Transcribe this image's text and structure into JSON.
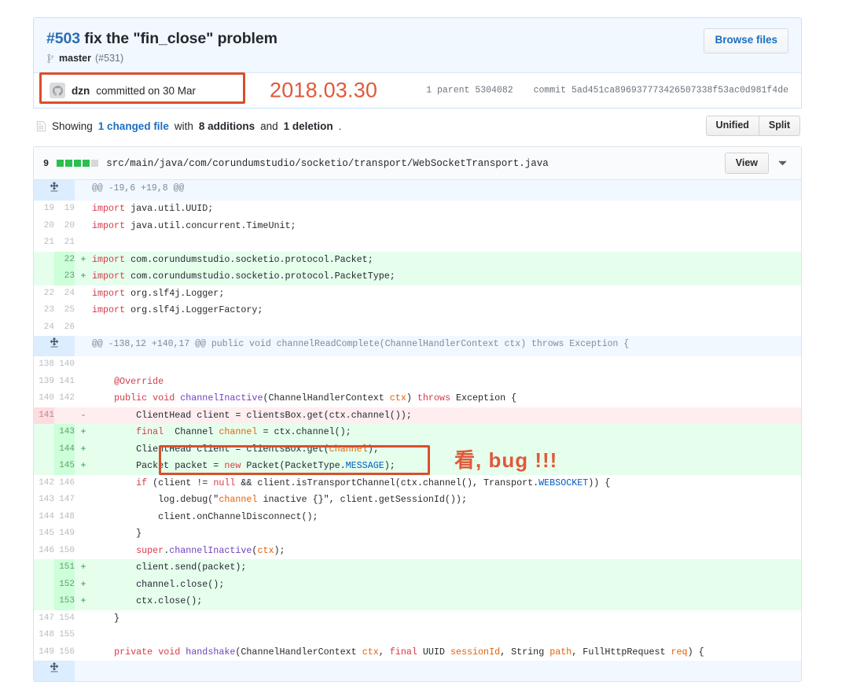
{
  "commit": {
    "number": "#503",
    "title_rest": " fix the \"fin_close\" problem",
    "branch_name": "master",
    "branch_pr": "(#531)",
    "browse_files_label": "Browse files",
    "author": "dzn",
    "committed_text": "committed on 30 Mar",
    "annotation_date": "2018.03.30",
    "parent_label": "1 parent",
    "parent_sha": "5304082",
    "commit_label": "commit",
    "commit_sha": "5ad451ca896937773426507338f53ac0d981f4de"
  },
  "summary": {
    "prefix": "Showing",
    "changed_file": "1 changed file",
    "with": "with",
    "additions": "8 additions",
    "and": "and",
    "deletions": "1 deletion",
    "period": ".",
    "view_unified": "Unified",
    "view_split": "Split"
  },
  "file": {
    "stat_count": "9",
    "stat_blocks": [
      "add",
      "add",
      "add",
      "add",
      "none"
    ],
    "path": "src/main/java/com/corundumstudio/socketio/transport/WebSocketTransport.java",
    "view_label": "View",
    "chevron": "chevron-down"
  },
  "annotations": {
    "bug_text": "看, bug !!!"
  },
  "hunks": [
    {
      "header": "@@ -19,6 +19,8 @@",
      "rows": [
        {
          "type": "ctx",
          "old": "19",
          "new": "19",
          "marker": "",
          "code": "import java.util.UUID;"
        },
        {
          "type": "ctx",
          "old": "20",
          "new": "20",
          "marker": "",
          "code": "import java.util.concurrent.TimeUnit;"
        },
        {
          "type": "ctx",
          "old": "21",
          "new": "21",
          "marker": "",
          "code": ""
        },
        {
          "type": "add",
          "old": "",
          "new": "22",
          "marker": "+",
          "code": "import com.corundumstudio.socketio.protocol.Packet;"
        },
        {
          "type": "add",
          "old": "",
          "new": "23",
          "marker": "+",
          "code": "import com.corundumstudio.socketio.protocol.PacketType;"
        },
        {
          "type": "ctx",
          "old": "22",
          "new": "24",
          "marker": "",
          "code": "import org.slf4j.Logger;"
        },
        {
          "type": "ctx",
          "old": "23",
          "new": "25",
          "marker": "",
          "code": "import org.slf4j.LoggerFactory;"
        },
        {
          "type": "ctx",
          "old": "24",
          "new": "26",
          "marker": "",
          "code": ""
        }
      ]
    },
    {
      "header": "@@ -138,12 +140,17 @@ public void channelReadComplete(ChannelHandlerContext ctx) throws Exception {",
      "rows": [
        {
          "type": "ctx",
          "old": "138",
          "new": "140",
          "marker": "",
          "code": ""
        },
        {
          "type": "ctx",
          "old": "139",
          "new": "141",
          "marker": "",
          "code": "    @Override"
        },
        {
          "type": "ctx",
          "old": "140",
          "new": "142",
          "marker": "",
          "code": "    public void channelInactive(ChannelHandlerContext ctx) throws Exception {"
        },
        {
          "type": "del",
          "old": "141",
          "new": "",
          "marker": "-",
          "code": "        ClientHead client = clientsBox.get(ctx.channel());"
        },
        {
          "type": "add",
          "old": "",
          "new": "143",
          "marker": "+",
          "code": "        final  Channel channel = ctx.channel();"
        },
        {
          "type": "add",
          "old": "",
          "new": "144",
          "marker": "+",
          "code": "        ClientHead client = clientsBox.get(channel);"
        },
        {
          "type": "add",
          "old": "",
          "new": "145",
          "marker": "+",
          "code": "        Packet packet = new Packet(PacketType.MESSAGE);"
        },
        {
          "type": "ctx",
          "old": "142",
          "new": "146",
          "marker": "",
          "code": "        if (client != null && client.isTransportChannel(ctx.channel(), Transport.WEBSOCKET)) {"
        },
        {
          "type": "ctx",
          "old": "143",
          "new": "147",
          "marker": "",
          "code": "            log.debug(\"channel inactive {}\", client.getSessionId());"
        },
        {
          "type": "ctx",
          "old": "144",
          "new": "148",
          "marker": "",
          "code": "            client.onChannelDisconnect();"
        },
        {
          "type": "ctx",
          "old": "145",
          "new": "149",
          "marker": "",
          "code": "        }"
        },
        {
          "type": "ctx",
          "old": "146",
          "new": "150",
          "marker": "",
          "code": "        super.channelInactive(ctx);"
        },
        {
          "type": "add",
          "old": "",
          "new": "151",
          "marker": "+",
          "code": "        client.send(packet);"
        },
        {
          "type": "add",
          "old": "",
          "new": "152",
          "marker": "+",
          "code": "        channel.close();"
        },
        {
          "type": "add",
          "old": "",
          "new": "153",
          "marker": "+",
          "code": "        ctx.close();"
        },
        {
          "type": "ctx",
          "old": "147",
          "new": "154",
          "marker": "",
          "code": "    }"
        },
        {
          "type": "ctx",
          "old": "148",
          "new": "155",
          "marker": "",
          "code": ""
        },
        {
          "type": "ctx",
          "old": "149",
          "new": "156",
          "marker": "",
          "code": "    private void handshake(ChannelHandlerContext ctx, final UUID sessionId, String path, FullHttpRequest req) {"
        }
      ]
    }
  ],
  "colors": {
    "add_bg": "#e6ffed",
    "del_bg": "#ffeef0",
    "hunk_bg": "#f1f8ff",
    "accent_link": "#1a6fc4",
    "annotation": "#d94f2b"
  }
}
